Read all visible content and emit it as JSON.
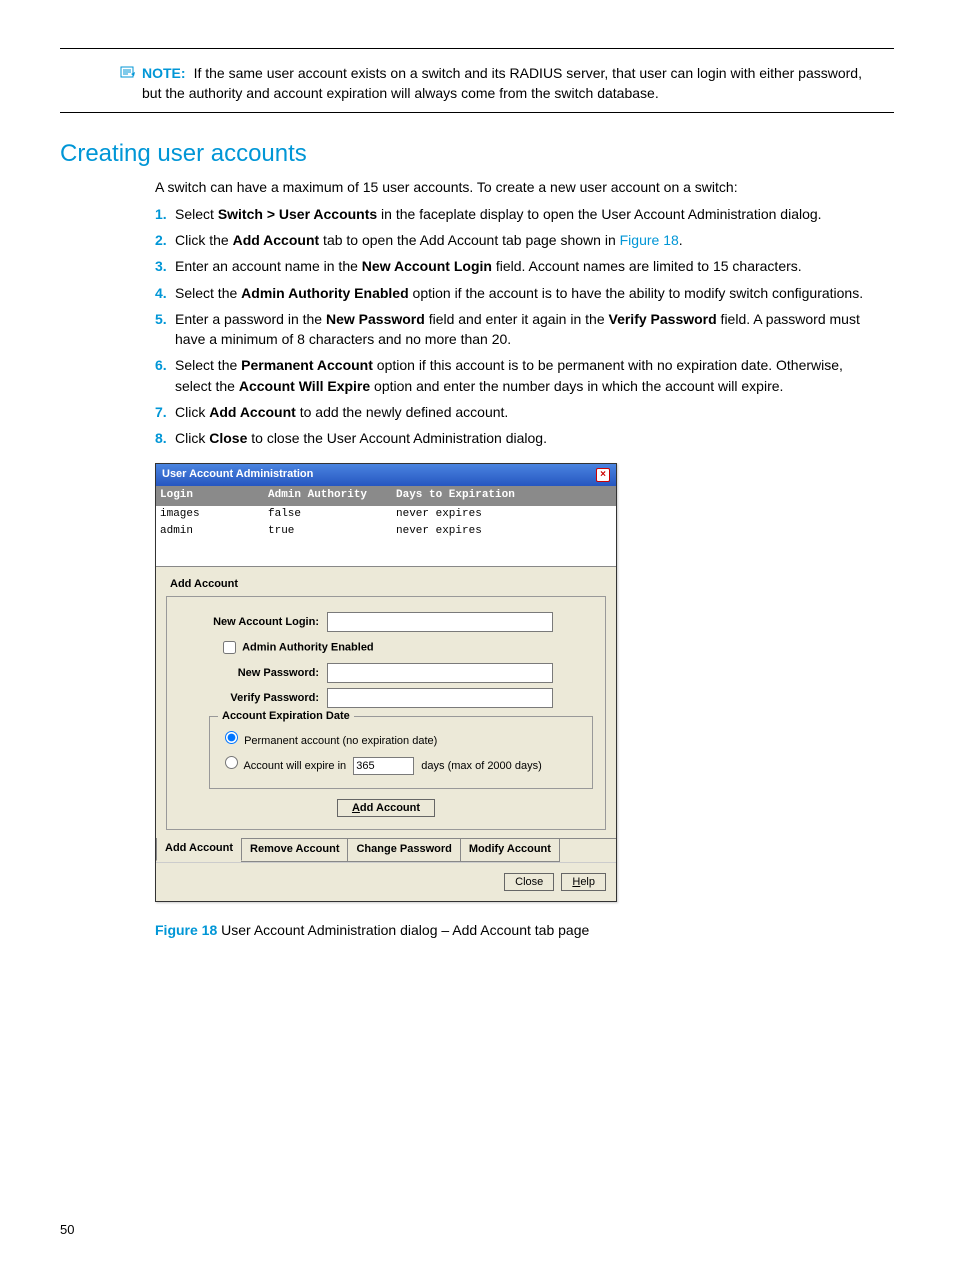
{
  "note": {
    "label": "NOTE:",
    "text": "If the same user account exists on a switch and its RADIUS server, that user can login with either password, but the authority and account expiration will always come from the switch database."
  },
  "section_title": "Creating user accounts",
  "intro": "A switch can have a maximum of 15 user accounts. To create a new user account on a switch:",
  "steps": {
    "s1a": "Select ",
    "s1b": "Switch > User Accounts",
    "s1c": " in the faceplate display to open the User Account Administration dialog.",
    "s2a": "Click the ",
    "s2b": "Add Account",
    "s2c": " tab to open the Add Account tab page shown in ",
    "s2d": "Figure 18",
    "s2e": ".",
    "s3a": "Enter an account name in the ",
    "s3b": "New Account Login",
    "s3c": " field. Account names are limited to 15 characters.",
    "s4a": "Select the ",
    "s4b": "Admin Authority Enabled",
    "s4c": " option if the account is to have the ability to modify switch configurations.",
    "s5a": "Enter a password in the ",
    "s5b": "New Password",
    "s5c": " field and enter it again in the ",
    "s5d": "Verify Password",
    "s5e": " field. A password must have a minimum of 8 characters and no more than 20.",
    "s6a": "Select the ",
    "s6b": "Permanent Account",
    "s6c": " option if this account is to be permanent with no expiration date. Otherwise, select the ",
    "s6d": "Account Will Expire",
    "s6e": " option and enter the number days in which the account will expire.",
    "s7a": "Click ",
    "s7b": "Add Account",
    "s7c": " to add the newly defined account.",
    "s8a": "Click ",
    "s8b": "Close",
    "s8c": " to close the User Account Administration dialog."
  },
  "dialog": {
    "title": "User Account Administration",
    "columns": {
      "login": "Login",
      "auth": "Admin Authority",
      "exp": "Days to Expiration"
    },
    "rows": [
      {
        "login": "images",
        "auth": "false",
        "exp": "never expires"
      },
      {
        "login": "admin",
        "auth": "true",
        "exp": "never expires"
      }
    ],
    "tab_caption": "Add Account",
    "labels": {
      "new_login": "New Account Login:",
      "admin_auth": "Admin Authority Enabled",
      "new_pw": "New Password:",
      "verify_pw": "Verify Password:",
      "exp_legend": "Account Expiration Date",
      "perm": "Permanent account (no expiration date)",
      "will_expire_a": "Account will expire in",
      "will_expire_b": "days (max of 2000 days)",
      "expire_value": "365",
      "add_btn_u": "A",
      "add_btn_rest": "dd Account"
    },
    "tabs": {
      "add": "Add Account",
      "remove": "Remove Account",
      "change": "Change Password",
      "modify": "Modify Account"
    },
    "footer": {
      "close": "Close",
      "help_u": "H",
      "help_rest": "elp"
    }
  },
  "figure": {
    "label": "Figure 18",
    "caption": " User Account Administration dialog – Add Account tab page"
  },
  "page_number": "50"
}
